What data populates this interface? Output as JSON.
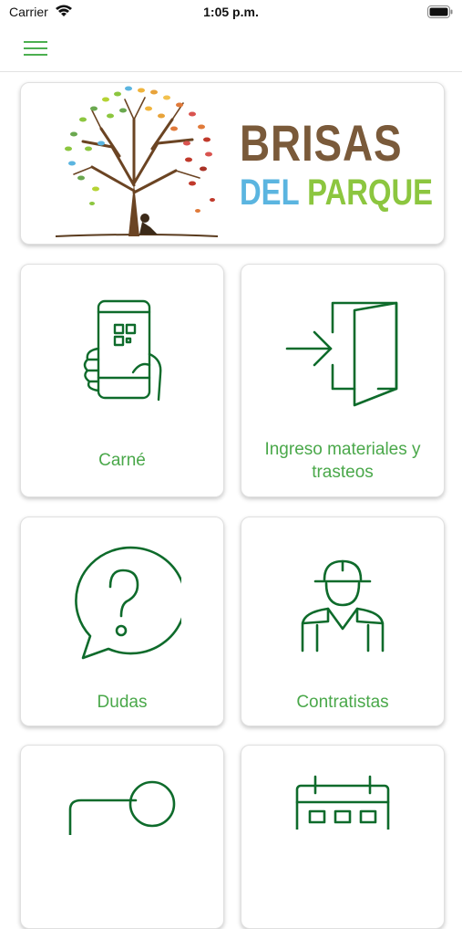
{
  "status_bar": {
    "carrier": "Carrier",
    "time": "1:05 p.m."
  },
  "nav": {
    "menu_icon": "hamburger-menu-icon"
  },
  "banner": {
    "brand_line_1": "BRISAS",
    "brand_line_2a": "DEL",
    "brand_line_2b": "PARQUE"
  },
  "tiles": [
    {
      "label": "Carné",
      "icon": "phone-qr-icon"
    },
    {
      "label": "Ingreso materiales y trasteos",
      "icon": "door-enter-icon"
    },
    {
      "label": "Dudas",
      "icon": "question-bubble-icon"
    },
    {
      "label": "Contratistas",
      "icon": "worker-icon"
    },
    {
      "label": "",
      "icon": "chat-icon"
    },
    {
      "label": "",
      "icon": "calendar-icon"
    }
  ],
  "colors": {
    "accent": "#0e6b2b",
    "label": "#4aa84a",
    "brand_brown": "#7a5a3a",
    "brand_blue": "#5bb5e0",
    "brand_green": "#8cc63f"
  }
}
